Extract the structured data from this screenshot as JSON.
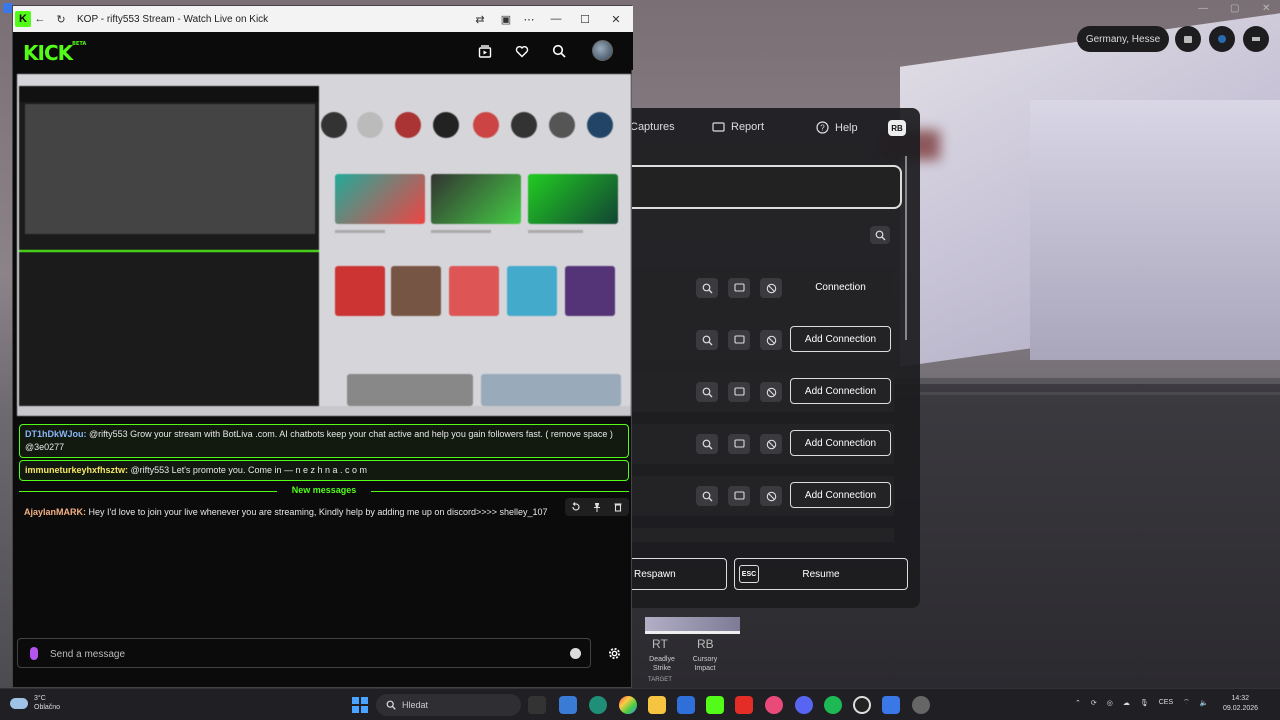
{
  "browser": {
    "title": "KOP - rifty553 Stream - Watch Live on Kick",
    "brand": "KICK",
    "brand_badge": "BETA"
  },
  "game": {
    "location_chip": "Germany, Hesse",
    "menu": {
      "nav": {
        "captures": "Captures",
        "report": "Report",
        "help": "Help",
        "rb_badge": "RB"
      },
      "rows": [
        {
          "action": "Connection",
          "style": "text"
        },
        {
          "action": "Add Connection",
          "style": "button"
        },
        {
          "action": "Add Connection",
          "style": "button"
        },
        {
          "action": "Add Connection",
          "style": "button"
        },
        {
          "action": "Add Connection",
          "style": "button"
        }
      ],
      "respawn": "Respawn",
      "resume": "Resume",
      "esc_key": "ESC"
    },
    "hud": {
      "rt_key": "RT",
      "rb_key": "RB",
      "rt_label": "Deadlye Strike",
      "rb_label": "Cursory Impact",
      "target": "TARGET"
    }
  },
  "chat": {
    "messages_highlighted": [
      {
        "user": "DT1hDkWJou:",
        "user_color": "#8ab4f8",
        "text": " @rifty553 Grow your stream with BotLiva .com. AI chatbots keep your chat active and help you gain followers fast. ( remove space ) @3e0277"
      },
      {
        "user": "immuneturkeyhxfhsztw:",
        "user_color": "#f5e663",
        "text": " @rifty553 Let's promote you. Come in — n e z h n a . c o m"
      }
    ],
    "new_messages_label": "New messages",
    "messages": [
      {
        "user": "AjaylanMARK:",
        "user_color": "#f4b183",
        "text": " Hey I'd love to join your live whenever you are streaming, Kindly help by adding me up on discord>>>> shelley_107"
      }
    ],
    "compose_placeholder": "Send a message"
  },
  "taskbar": {
    "weather_temp": "3°C",
    "weather_desc": "Oblačno",
    "search_placeholder": "Hledat",
    "lang": "CES",
    "time": "14:32",
    "date": "09.02.2026"
  },
  "colors": {
    "kick_green": "#53fc18",
    "accent_purple": "#b454f0"
  }
}
